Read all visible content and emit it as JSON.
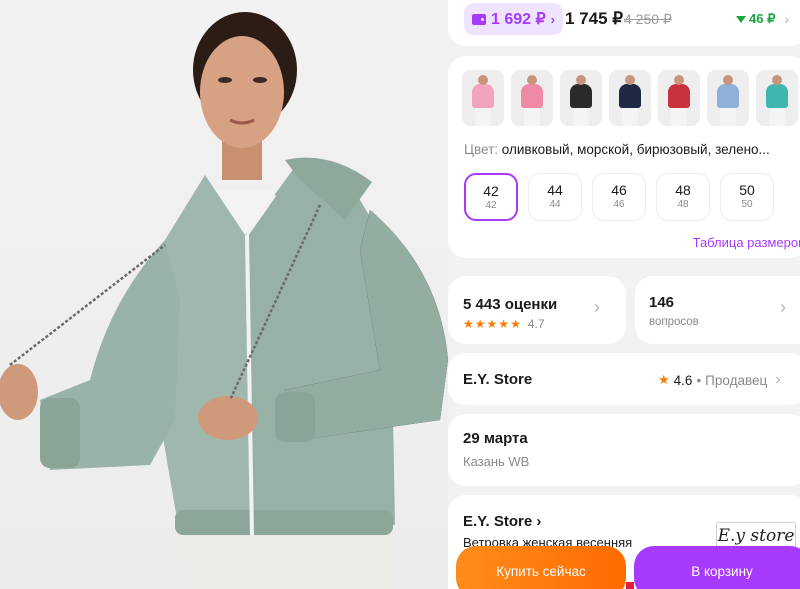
{
  "price": {
    "wallet_price": "1 692 ₽",
    "wallet_chevron": "›",
    "main_price": "1 745 ₽",
    "old_price": "4 250 ₽",
    "cashback": "46 ₽",
    "cashback_chevron": "›"
  },
  "variants": {
    "thumbnails": [
      {
        "color": "#f2a3bd"
      },
      {
        "color": "#ef8aa6"
      },
      {
        "color": "#2a2a2a"
      },
      {
        "color": "#1e2a44"
      },
      {
        "color": "#c8323c"
      },
      {
        "color": "#8fb0d8"
      },
      {
        "color": "#3fb7b0"
      }
    ],
    "color_label": "Цвет:",
    "color_value": "оливковый, морской, бирюзовый, зелено...",
    "sizes": [
      {
        "main": "42",
        "sub": "42",
        "selected": true
      },
      {
        "main": "44",
        "sub": "44",
        "selected": false
      },
      {
        "main": "46",
        "sub": "46",
        "selected": false
      },
      {
        "main": "48",
        "sub": "48",
        "selected": false
      },
      {
        "main": "50",
        "sub": "50",
        "selected": false
      }
    ],
    "size_table_link": "Таблица размеров"
  },
  "reviews": {
    "title": "5 443 оценки",
    "stars": 5,
    "rating": "4.7"
  },
  "questions": {
    "count": "146",
    "label": "вопросов"
  },
  "store": {
    "name": "E.Y. Store",
    "rating": "4.6",
    "dot": "•",
    "role": "Продавец",
    "chevron": "›"
  },
  "delivery": {
    "date": "29 марта",
    "city": "Казань WB"
  },
  "seller": {
    "name": "E.Y. Store ›",
    "description": "Ветровка женская весенняя",
    "watermark": "E.y store"
  },
  "actions": {
    "buy_now": "Купить сейчас",
    "add_to_cart": "В корзину"
  },
  "colors": {
    "accent": "#a73afd",
    "orange": "#ff7a00",
    "green": "#1aa53e"
  }
}
